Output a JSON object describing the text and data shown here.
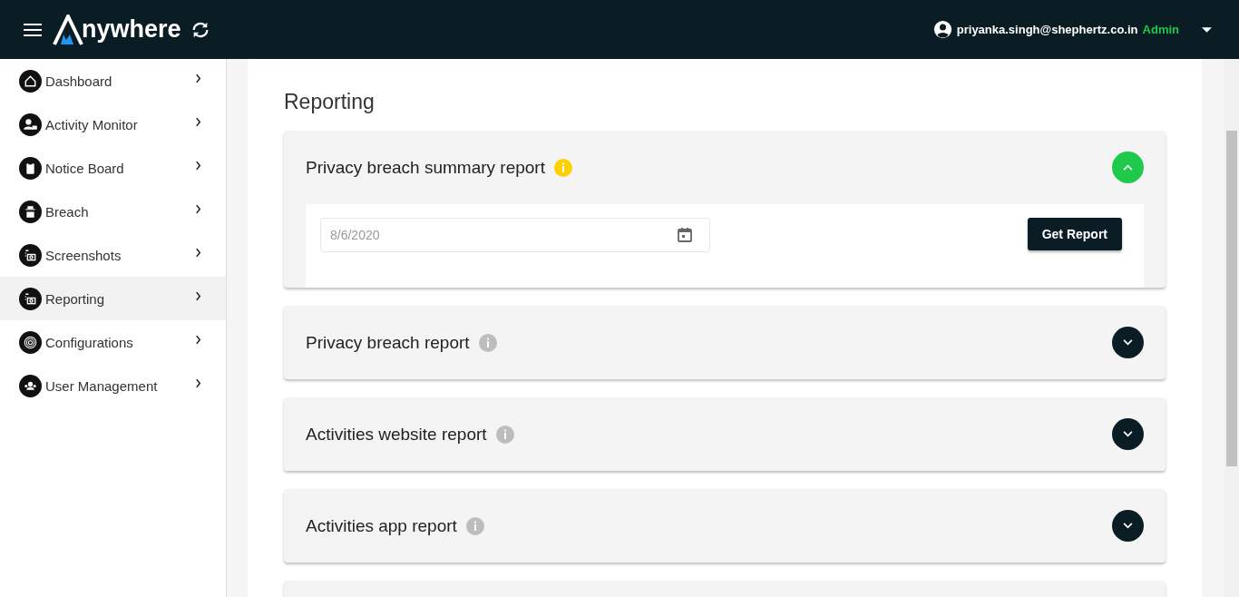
{
  "header": {
    "brand": "nywhere",
    "user_email": "priyanka.singh@shephertz.co.in",
    "user_role": "Admin"
  },
  "sidebar": {
    "items": [
      {
        "label": "Dashboard",
        "selected": false
      },
      {
        "label": "Activity Monitor",
        "selected": false
      },
      {
        "label": "Notice Board",
        "selected": false
      },
      {
        "label": "Breach",
        "selected": false
      },
      {
        "label": "Screenshots",
        "selected": false
      },
      {
        "label": "Reporting",
        "selected": true
      },
      {
        "label": "Configurations",
        "selected": false
      },
      {
        "label": "User Management",
        "selected": false
      }
    ]
  },
  "page_title": "Reporting",
  "reports": [
    {
      "title": "Privacy breach summary report",
      "expanded": true,
      "date": "8/6/2020",
      "button": "Get Report"
    },
    {
      "title": "Privacy breach report",
      "expanded": false
    },
    {
      "title": "Activities website report",
      "expanded": false
    },
    {
      "title": "Activities app report",
      "expanded": false
    }
  ]
}
